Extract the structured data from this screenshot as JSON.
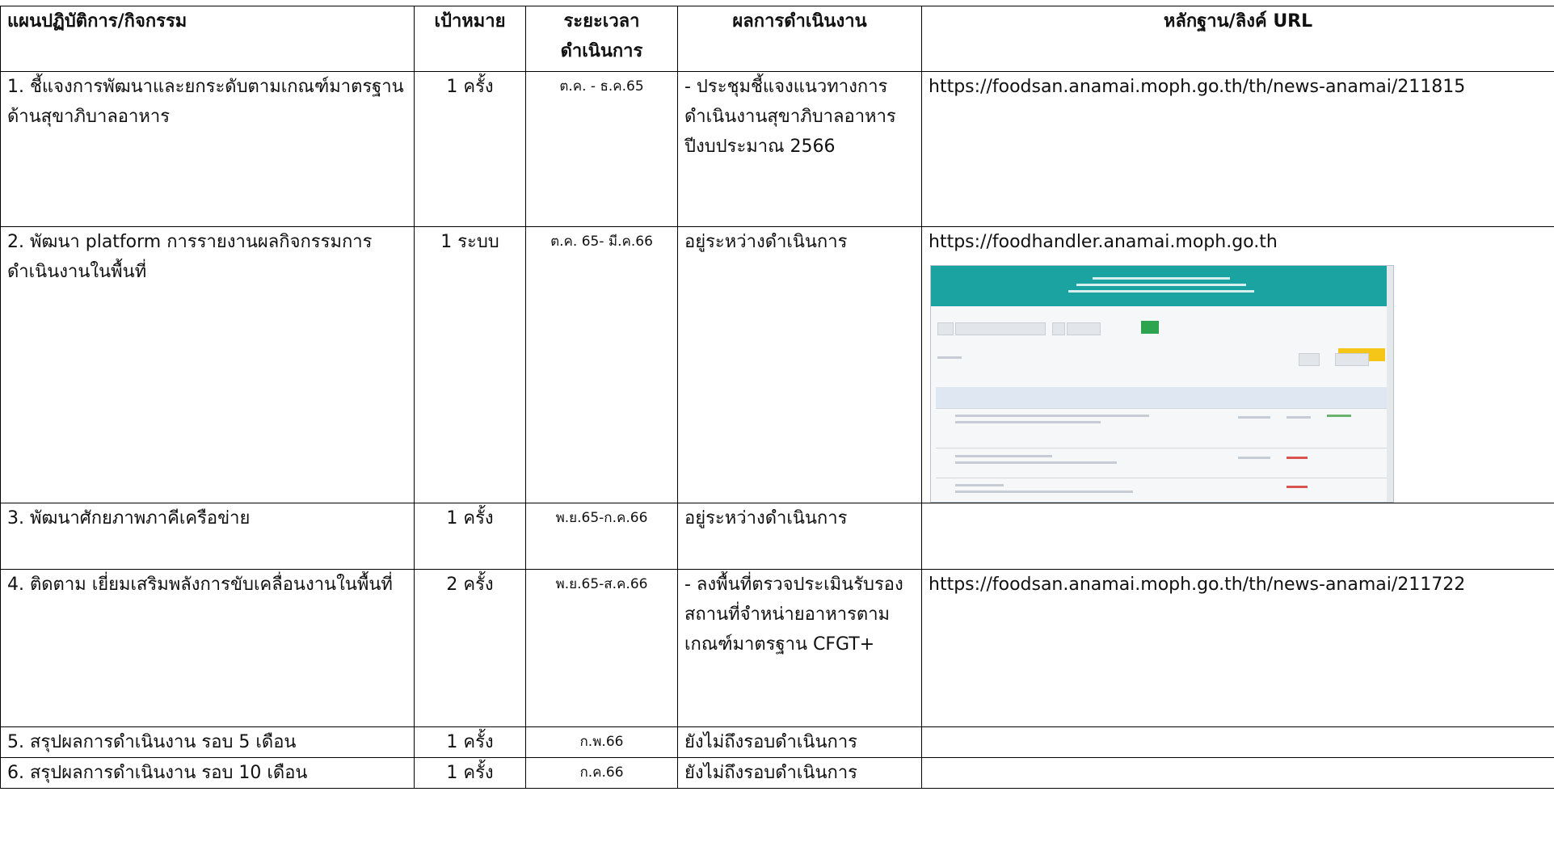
{
  "header": {
    "plan": "แผนปฏิบัติการ/กิจกรรม",
    "goal": "เป้าหมาย",
    "duration": "ระยะเวลาดำเนินการ",
    "result": "ผลการดำเนินงาน",
    "evidence": "หลักฐาน/ลิงค์ URL"
  },
  "rows": [
    {
      "plan": "1. ชี้แจงการพัฒนาและยกระดับตามเกณฑ์มาตรฐานด้านสุขาภิบาลอาหาร",
      "goal": "1 ครั้ง",
      "duration": "ต.ค. - ธ.ค.65",
      "result": "- ประชุมชี้แจงแนวทางการดำเนินงานสุขาภิบาลอาหารปีงบประมาณ 2566",
      "evidence": "https://foodsan.anamai.moph.go.th/th/news-anamai/211815"
    },
    {
      "plan": "2. พัฒนา platform การรายงานผลกิจกรรมการดำเนินงานในพื้นที่",
      "goal": "1 ระบบ",
      "duration": "ต.ค. 65- มี.ค.66",
      "result": "อยู่ระหว่างดำเนินการ",
      "evidence": "https://foodhandler.anamai.moph.go.th"
    },
    {
      "plan": "3. พัฒนาศักยภาพภาคีเครือข่าย",
      "goal": "1 ครั้ง",
      "duration": "พ.ย.65-ก.ค.66",
      "result": "อยู่ระหว่างดำเนินการ",
      "evidence": ""
    },
    {
      "plan": "4. ติดตาม เยี่ยมเสริมพลังการขับเคลื่อนงานในพื้นที่",
      "goal": "2 ครั้ง",
      "duration": "พ.ย.65-ส.ค.66",
      "result": "- ลงพื้นที่ตรวจประเมินรับรองสถานที่จำหน่ายอาหารตามเกณฑ์มาตรฐาน CFGT+",
      "evidence": "https://foodsan.anamai.moph.go.th/th/news-anamai/211722"
    },
    {
      "plan": "5. สรุปผลการดำเนินงาน รอบ 5 เดือน",
      "goal": "1 ครั้ง",
      "duration": "ก.พ.66",
      "result": "ยังไม่ถึงรอบดำเนินการ",
      "evidence": ""
    },
    {
      "plan": "6. สรุปผลการดำเนินงาน รอบ 10 เดือน",
      "goal": "1 ครั้ง",
      "duration": "ก.ค.66",
      "result": "ยังไม่ถึงรอบดำเนินการ",
      "evidence": ""
    }
  ]
}
